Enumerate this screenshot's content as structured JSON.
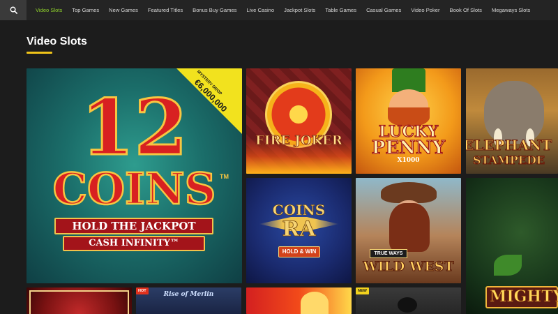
{
  "nav": {
    "search_icon": "search-icon",
    "items": [
      {
        "label": "Video Slots"
      },
      {
        "label": "Top Games"
      },
      {
        "label": "New Games"
      },
      {
        "label": "Featured Titles"
      },
      {
        "label": "Bonus Buy Games"
      },
      {
        "label": "Live Casino"
      },
      {
        "label": "Jackpot Slots"
      },
      {
        "label": "Table Games"
      },
      {
        "label": "Casual Games"
      },
      {
        "label": "Video Poker"
      },
      {
        "label": "Book Of Slots"
      },
      {
        "label": "Megaways Slots"
      }
    ]
  },
  "section": {
    "title": "Video Slots"
  },
  "tiles": {
    "coins12": {
      "line1": "12",
      "line2": "COINS",
      "tm": "TM",
      "line3": "HOLD THE JACKPOT",
      "line4": "CASH INFINITY™",
      "ribbon_top": "MYSTERY DROP",
      "ribbon_amount": "€6,000,000"
    },
    "firejoker": {
      "label": "FIRE JOKER"
    },
    "luckypenny": {
      "line1": "LUCKY",
      "line2": "PENNY",
      "line3": "X1000"
    },
    "elephant": {
      "line1": "ELEPHANT",
      "line2": "STAMPEDE"
    },
    "coinsra": {
      "line1": "COINS",
      "line2": "RA",
      "line3": "HOLD & WIN"
    },
    "wildwest": {
      "line1": "TRUE WAYS",
      "line2": "WILD WEST"
    },
    "mighty": {
      "line1": "MIGHTY"
    },
    "merlin": {
      "label": "Rise of Merlin",
      "badge": "HOT"
    },
    "newtile": {
      "badge": "NEW"
    }
  },
  "colors": {
    "accent_green": "#8fd12c",
    "underline_yellow": "#f0c419",
    "background": "#1c1c1c"
  }
}
